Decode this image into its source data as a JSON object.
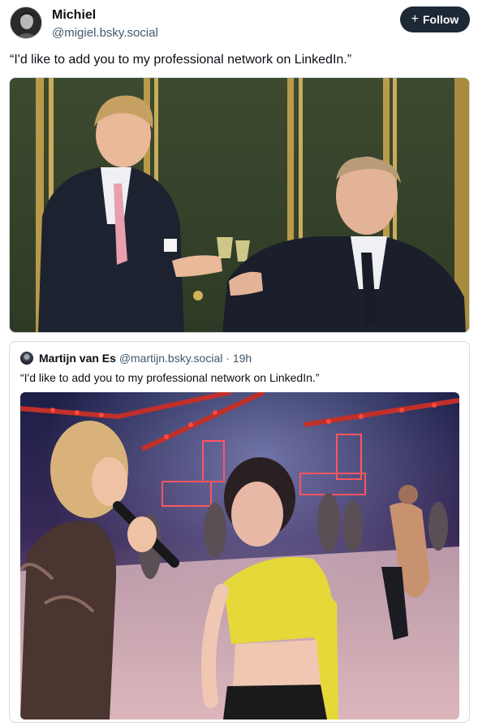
{
  "post": {
    "author": {
      "display_name": "Michiel",
      "handle": "@migiel.bsky.social",
      "avatar_icon": "avatar-icon"
    },
    "follow_label": "Follow",
    "follow_icon": "plus-icon",
    "text": "“I'd like to add you to my professional network on LinkedIn.”",
    "media": {
      "image_kind": "photo",
      "icon": "image-icon"
    }
  },
  "quote": {
    "author": {
      "display_name": "Martijn van Es",
      "handle": "@martijn.bsky.social",
      "separator": "·",
      "time": "19h"
    },
    "text": "“I'd like to add you to my professional network on LinkedIn.”",
    "media": {
      "image_kind": "photo"
    }
  },
  "colors": {
    "follow_bg": "#1e2936",
    "text_primary": "#0b0f14",
    "text_secondary": "#42576c",
    "border": "#d4dbe2"
  }
}
